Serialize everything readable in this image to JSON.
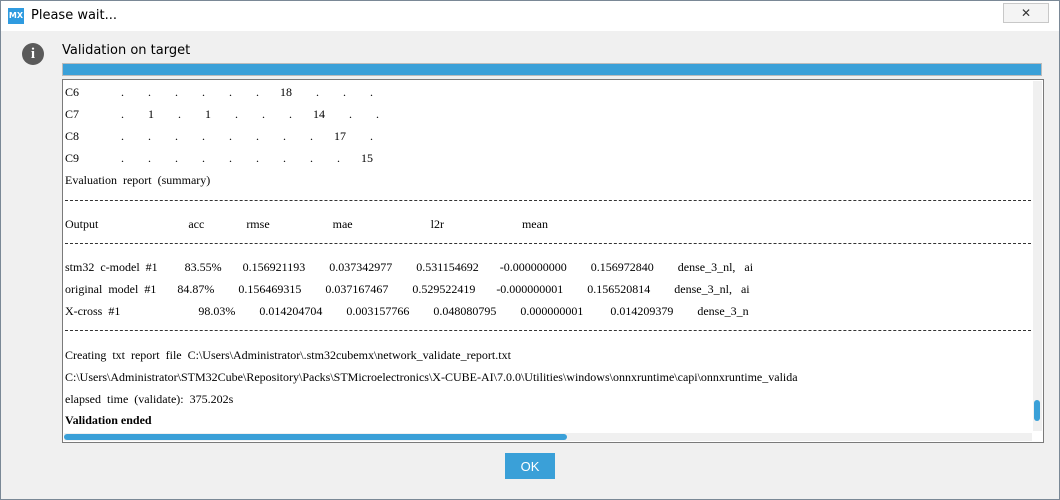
{
  "window": {
    "icon_text": "MX",
    "title": "Please wait...",
    "close_glyph": "✕"
  },
  "dialog": {
    "info_icon_glyph": "i",
    "heading": "Validation on target",
    "progress_fraction": 1.0,
    "ok_label": "OK"
  },
  "log": {
    "matrix_rows": [
      "C6              .        .        .        .        .        .       18        .        .        .",
      "C7              .        1        .        1        .        .        .       14        .        .",
      "C8              .        .        .        .        .        .        .        .       17        .",
      "C9              .        .        .        .        .        .        .        .        .       15"
    ],
    "report_title": "Evaluation  report  (summary)",
    "header_row": "Output                              acc              rmse                     mae                          l2r                          mean",
    "result_rows": [
      "stm32  c-model  #1         83.55%       0.156921193        0.037342977        0.531154692       -0.000000000        0.156972840        dense_3_nl,   ai",
      "original  model  #1       84.87%        0.156469315        0.037167467        0.529522419       -0.000000001        0.156520814        dense_3_nl,   ai",
      "X-cross  #1                          98.03%        0.014204704        0.003157766        0.048080795        0.000000001         0.014209379        dense_3_n"
    ],
    "footer_lines": [
      "Creating  txt  report  file  C:\\Users\\Administrator\\.stm32cubemx\\network_validate_report.txt",
      "C:\\Users\\Administrator\\STM32Cube\\Repository\\Packs\\STMicroelectronics\\X-CUBE-AI\\7.0.0\\Utilities\\windows\\onnxruntime\\capi\\onnxruntime_valida",
      "elapsed  time  (validate):  375.202s"
    ],
    "final_line": "Validation ended",
    "hscroll_fraction": 0.52,
    "vscroll_position": 0.97,
    "vscroll_fraction": 0.06
  }
}
